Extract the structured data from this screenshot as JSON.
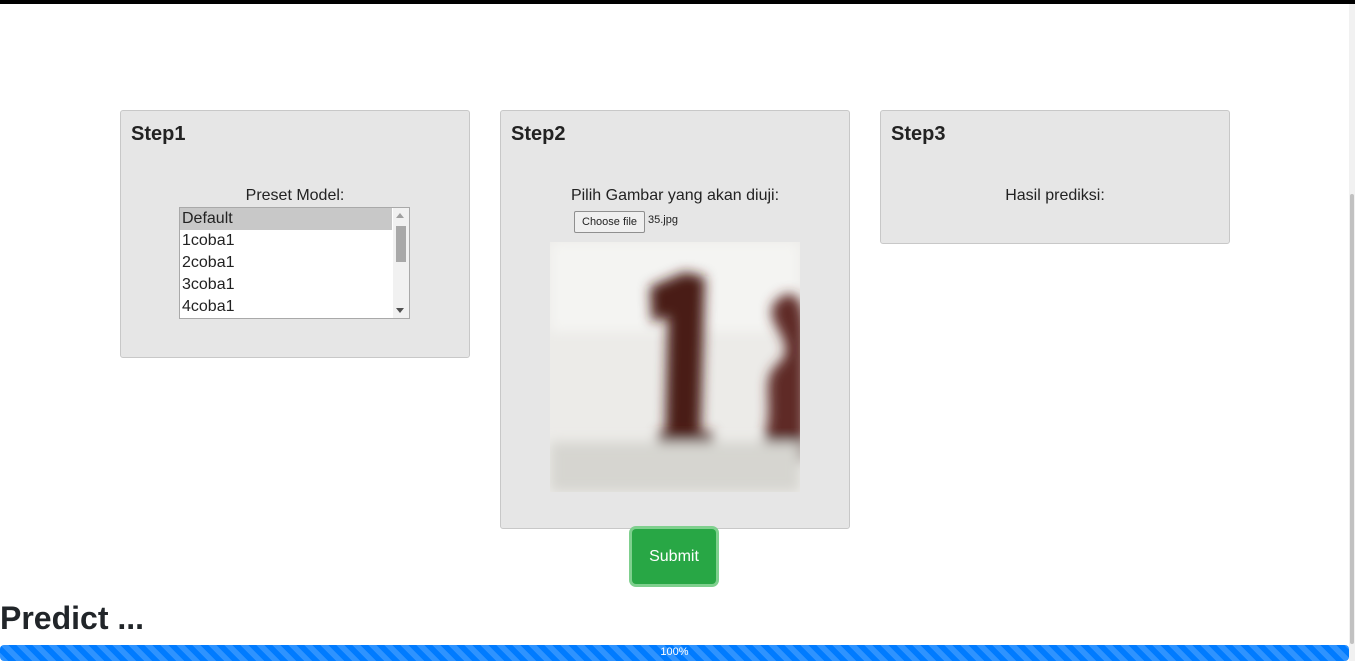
{
  "step1": {
    "title": "Step1",
    "label": "Preset Model:",
    "options": [
      "Default",
      "1coba1",
      "2coba1",
      "3coba1",
      "4coba1"
    ],
    "selected": "Default"
  },
  "step2": {
    "title": "Step2",
    "label": "Pilih Gambar yang akan diuji:",
    "file_button": "Choose file",
    "file_name": "35.jpg"
  },
  "step3": {
    "title": "Step3",
    "label": "Hasil prediksi:"
  },
  "submit_label": "Submit",
  "predict_heading": "Predict ...",
  "progress": {
    "value": 100,
    "label": "100%"
  },
  "colors": {
    "submit": "#28a745",
    "progress": "#007bff",
    "card": "#e6e6e6"
  }
}
